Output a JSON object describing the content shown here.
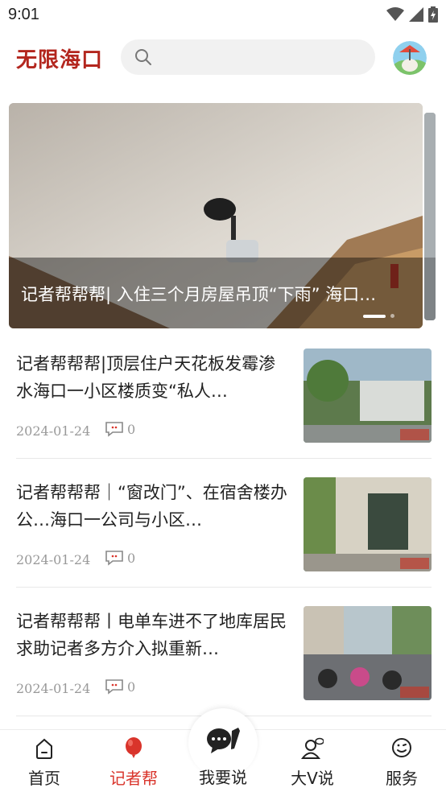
{
  "status_bar": {
    "time": "9:01"
  },
  "header": {
    "logo": "无限海口",
    "search_placeholder": ""
  },
  "banner": {
    "title": "记者帮帮帮| 入住三个月房屋吊顶“下雨” 海口…",
    "slide_index": 1,
    "slide_count": 2
  },
  "news": [
    {
      "title": "记者帮帮帮|顶层住户天花板发霉渗水海口一小区楼质变“私人…",
      "date": "2024-01-24",
      "comments": "0"
    },
    {
      "title": "记者帮帮帮｜“窗改门”、在宿舍楼办公…海口一公司与小区…",
      "date": "2024-01-24",
      "comments": "0"
    },
    {
      "title": "记者帮帮帮丨电单车进不了地库居民求助记者多方介入拟重新…",
      "date": "2024-01-24",
      "comments": "0"
    }
  ],
  "bottom_nav": {
    "items": [
      {
        "label": "首页",
        "icon": "home-icon"
      },
      {
        "label": "记者帮",
        "icon": "balloon-icon",
        "active": true
      },
      {
        "label": "我要说",
        "icon": "chat-pen-icon"
      },
      {
        "label": "大V说",
        "icon": "user-chat-icon"
      },
      {
        "label": "服务",
        "icon": "smile-face-icon"
      }
    ]
  },
  "colors": {
    "brand": "#b3261e",
    "active_nav": "#d9342b"
  }
}
